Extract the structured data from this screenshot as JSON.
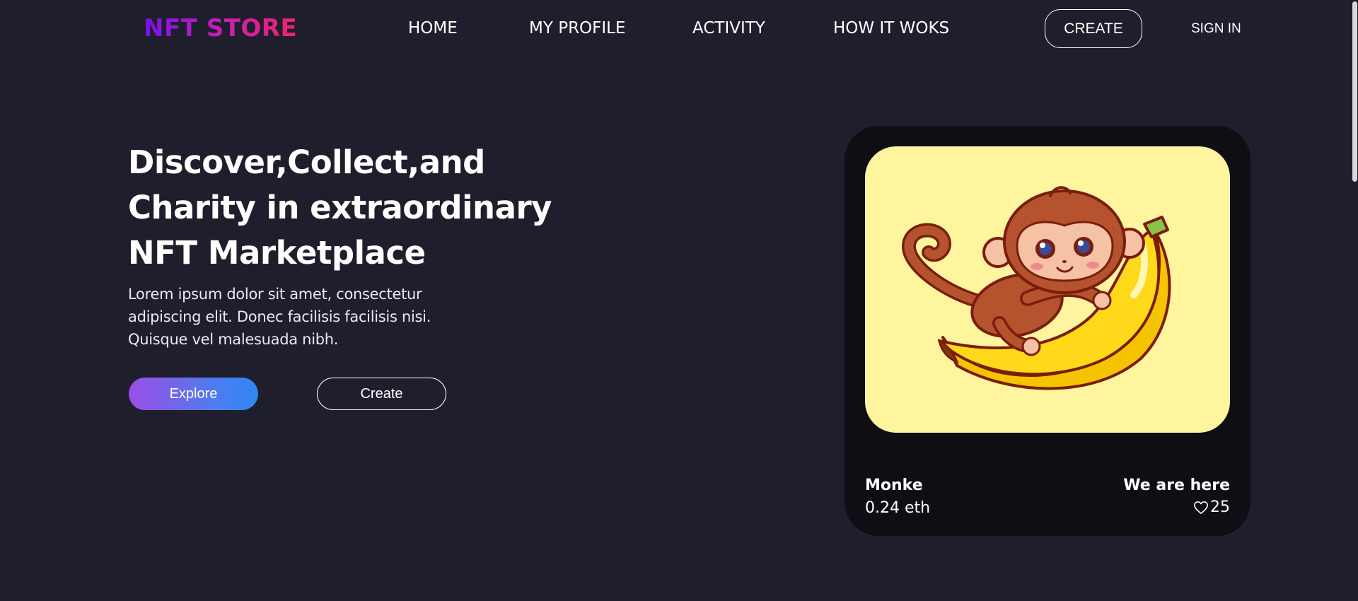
{
  "header": {
    "logo": "NFT STORE",
    "nav": [
      "HOME",
      "MY PROFILE",
      "ACTIVITY",
      "HOW IT WOKS"
    ],
    "create_label": "CREATE",
    "sign_in_label": "SIGN IN"
  },
  "hero": {
    "title_lines": [
      "Discover,Collect,and",
      "Charity in extraordinary",
      "NFT Marketplace"
    ],
    "description": "Lorem ipsum dolor sit amet, consectetur adipiscing elit. Donec facilisis facilisis nisi. Quisque vel malesuada nibh.",
    "explore_label": "Explore",
    "create_label": "Create"
  },
  "card": {
    "name": "Monke",
    "price": "0.24 eth",
    "tag": "We are here",
    "likes": "25",
    "image_icon": "monkey-on-banana-illustration",
    "image_bg": "#fff59f"
  },
  "colors": {
    "background": "#1f1e2c",
    "card_background": "#0f0e15",
    "logo_gradient": [
      "#7b0ff0",
      "#f0246e"
    ],
    "explore_gradient": [
      "#9b4ee6",
      "#2f86f2"
    ]
  }
}
